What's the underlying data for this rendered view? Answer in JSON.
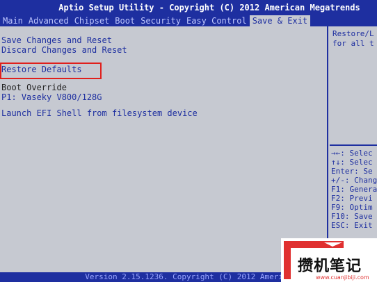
{
  "title_bar": "Aptio Setup Utility - Copyright (C) 2012 American Megatrends",
  "menu": [
    "Main",
    "Advanced",
    "Chipset",
    "Boot",
    "Security",
    "Easy Control",
    "Save & Exit"
  ],
  "active_menu": "Save & Exit",
  "options": {
    "save_reset": "Save Changes and Reset",
    "discard_reset": "Discard Changes and Reset",
    "restore_defaults": "Restore Defaults",
    "boot_override": "Boot Override",
    "boot_device": "P1: Vaseky V800/128G",
    "launch_efi": "Launch EFI Shell from filesystem device"
  },
  "help": {
    "line1": "Restore/L",
    "line2": "for all t",
    "keys": [
      "→←: Selec",
      "↑↓: Selec",
      "Enter: Se",
      "+/-: Chang",
      "F1: Genera",
      "F2: Previ",
      "F9: Optim",
      "F10: Save",
      "ESC: Exit"
    ]
  },
  "footer": "Version 2.15.1236. Copyright (C) 2012 American Megatrends",
  "watermark": {
    "text": "攒机笔记",
    "url": "www.cuanjibiji.com"
  },
  "colors": {
    "accent": "#1e2fa0",
    "background": "#c6c9d1",
    "highlight_border": "#e0201c"
  }
}
